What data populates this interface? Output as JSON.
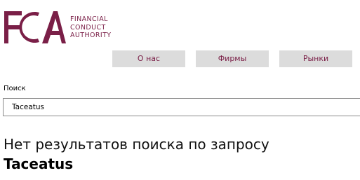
{
  "brand": {
    "logo_letters": "FCA",
    "name_lines": [
      "FINANCIAL",
      "CONDUCT",
      "AUTHORITY"
    ],
    "color": "#7a1f47"
  },
  "nav": {
    "items": [
      {
        "label": "О нас"
      },
      {
        "label": "Фирмы"
      },
      {
        "label": "Рынки"
      }
    ],
    "link_color": "#7a1f47",
    "button_bg": "#dcdcdc"
  },
  "search": {
    "label": "Поиск",
    "value": "Taceatus"
  },
  "results": {
    "message": "Нет результатов поиска по запросу",
    "query": "Taceatus"
  }
}
